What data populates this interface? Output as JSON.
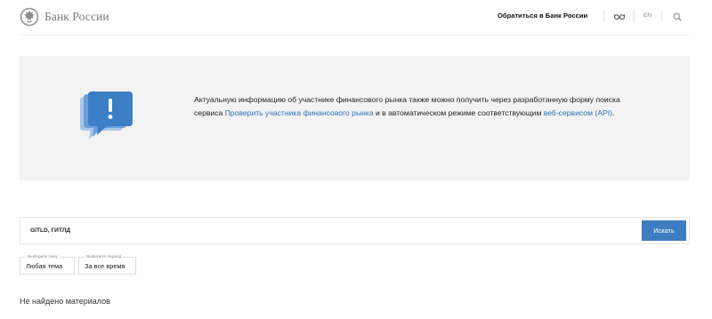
{
  "header": {
    "logo_text": "Банк России",
    "contact_link": "Обратиться в Банк России",
    "lang_label": "EN",
    "icons": [
      "emblem-icon",
      "accessibility-glasses-icon",
      "search-icon"
    ]
  },
  "info": {
    "text_before": "Актуальную информацию об участнике финансового рынка также можно получить через разработанную форму поиска сервиса ",
    "link_check": "Проверить участника финансового рынка",
    "text_middle": " и в автоматическом режиме соответствующим ",
    "link_api": "веб-сервисом (API)",
    "text_after": ".",
    "icon": "exclamation-chat-icon"
  },
  "search": {
    "value": "GITLD, ГИТЛД",
    "button_label": "Искать"
  },
  "filters": {
    "topic_caption": "Выберите тему",
    "topic_value": "Любая тема",
    "period_caption": "Выберите период",
    "period_value": "За все время"
  },
  "results": {
    "empty_message": "Не найдено материалов"
  },
  "colors": {
    "accent": "#3e7dc2",
    "link": "#2f6db3",
    "panel_bg": "#f3f3f3",
    "icon_blue": "#3d7fc6"
  }
}
